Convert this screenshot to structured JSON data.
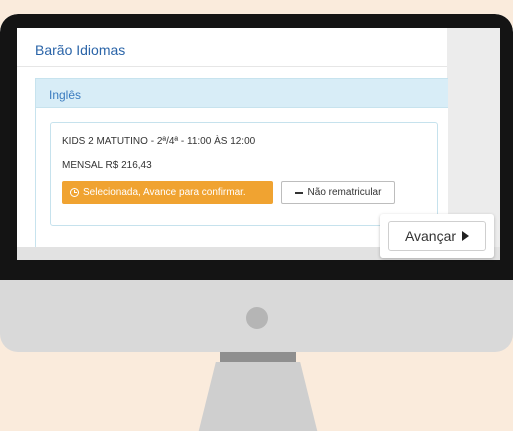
{
  "site": {
    "brand": "Barão Idiomas"
  },
  "panel": {
    "title": "Inglês"
  },
  "course": {
    "description": "KIDS 2 MATUTINO - 2ª/4ª - 11:00 ÀS 12:00",
    "price": "MENSAL R$ 216,43",
    "selected_label": "Selecionada, Avance para confirmar.",
    "no_renew_label": "Não rematricular"
  },
  "actions": {
    "advance_label": "Avançar"
  },
  "icons": {
    "selected": "clock-icon",
    "no_renew": "minus-icon",
    "advance": "play-icon"
  },
  "colors": {
    "background": "#faebdc",
    "brand_blue": "#2a64a8",
    "panel_header": "#d8edf7",
    "selected_orange": "#f0a331"
  }
}
